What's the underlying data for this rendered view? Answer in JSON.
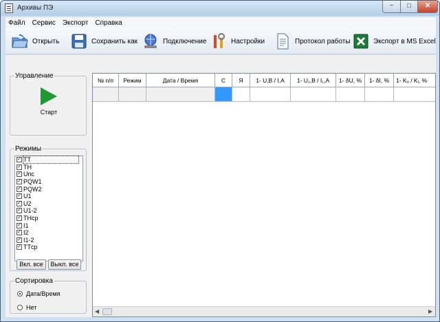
{
  "window": {
    "title": "Архивы ПЭ",
    "min": "−",
    "max": "□",
    "close": "✕"
  },
  "menu": [
    "Файл",
    "Сервис",
    "Экспорт",
    "Справка"
  ],
  "toolbar": {
    "open": "Открыть",
    "save_as": "Сохранить как",
    "connect": "Подключение",
    "settings": "Настройки",
    "protocol": "Протокол работы",
    "excel": "Экспорт в MS Excel"
  },
  "control": {
    "title": "Управление",
    "start": "Старт"
  },
  "modes": {
    "title": "Режимы",
    "items": [
      "ТТ",
      "ТН",
      "Uпс",
      "PQW1",
      "PQW2",
      "U1",
      "U2",
      "U1-2",
      "THср",
      "I1",
      "I2",
      "I1-2",
      "TTср"
    ],
    "check": "✓",
    "all_on": "Вкл. все",
    "all_off": "Выкл. все"
  },
  "sort": {
    "title": "Сортировка",
    "opt1": "Дата/Время",
    "opt2": "Нет"
  },
  "grid": {
    "columns": [
      "№ п/п",
      "Режим",
      "Дата / Время",
      "С",
      "Я",
      "1- U,В / I,А",
      "1- U₁,В / I₁,А",
      "1- δU, %",
      "1- δI, %",
      "1- Kᵤ / Kᵢ, %"
    ],
    "scroll_left": "◀",
    "scroll_right": "▶"
  }
}
